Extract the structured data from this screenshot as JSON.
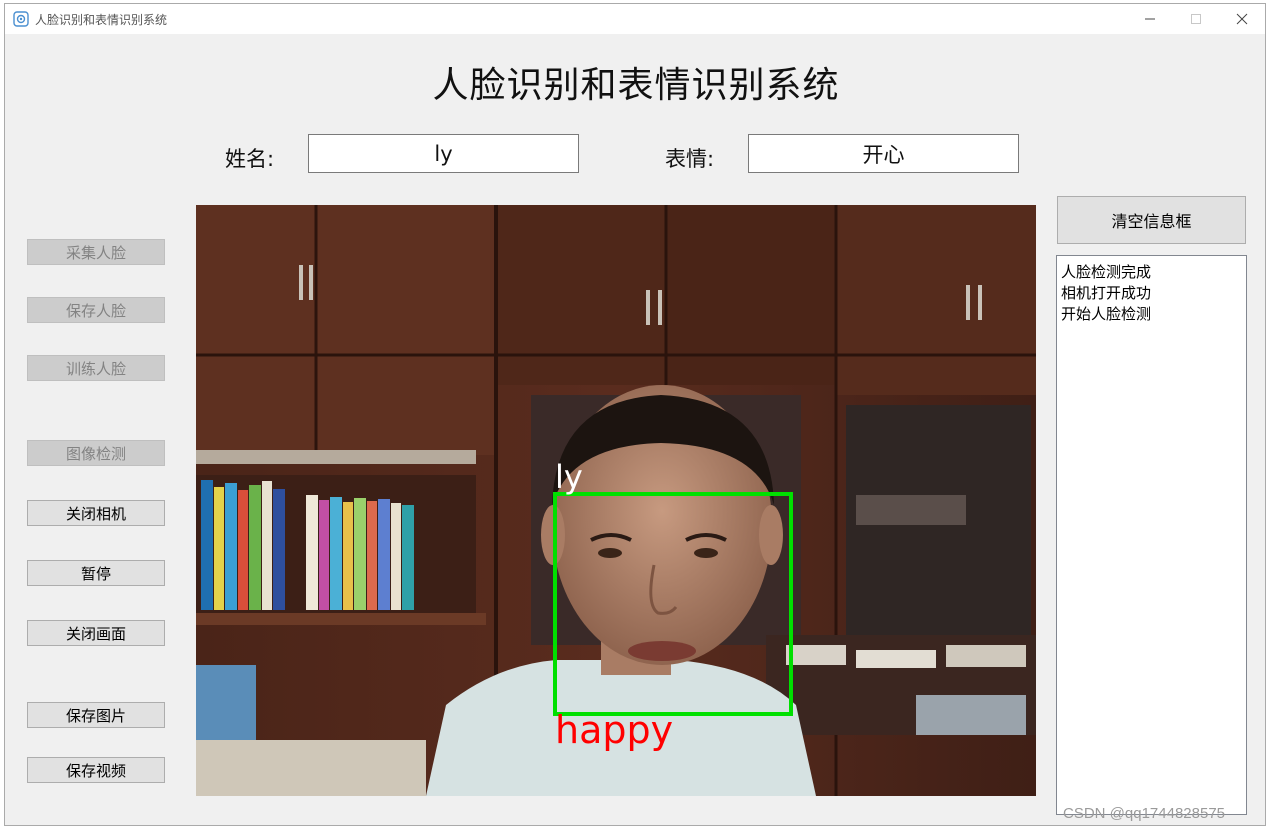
{
  "window": {
    "title": "人脸识别和表情识别系统"
  },
  "header": {
    "title": "人脸识别和表情识别系统"
  },
  "fields": {
    "name_label": "姓名:",
    "name_value": "ly",
    "expression_label": "表情:",
    "expression_value": "开心"
  },
  "sidebar": {
    "buttons": [
      {
        "label": "采集人脸",
        "enabled": false
      },
      {
        "label": "保存人脸",
        "enabled": false
      },
      {
        "label": "训练人脸",
        "enabled": false
      },
      {
        "label": "图像检测",
        "enabled": false
      },
      {
        "label": "关闭相机",
        "enabled": true
      },
      {
        "label": "暂停",
        "enabled": true
      },
      {
        "label": "关闭画面",
        "enabled": true
      },
      {
        "label": "保存图片",
        "enabled": true
      },
      {
        "label": "保存视频",
        "enabled": true
      }
    ]
  },
  "video": {
    "face_name": "ly",
    "expression": "happy",
    "box_color": "#00e000",
    "name_color": "#ffffff",
    "expression_color": "#ff0000"
  },
  "right_panel": {
    "clear_button": "清空信息框",
    "log": [
      "人脸检测完成",
      "相机打开成功",
      "开始人脸检测"
    ]
  },
  "watermark": "CSDN @qq1744828575"
}
